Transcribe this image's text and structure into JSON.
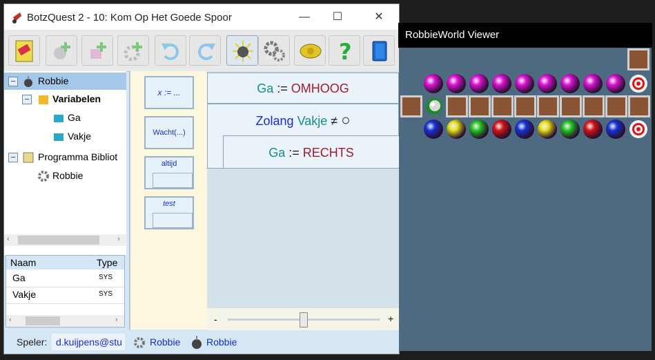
{
  "main_window": {
    "title": "BotzQuest 2 - 10: Kom Op Het Goede Spoor",
    "controls": {
      "minimize": "—",
      "maximize": "☐",
      "close": "✕"
    }
  },
  "toolbar": {
    "buttons": [
      {
        "name": "new-program-icon"
      },
      {
        "name": "add-robot-icon"
      },
      {
        "name": "add-variable-icon"
      },
      {
        "name": "add-setting-icon"
      },
      {
        "name": "undo-icon"
      },
      {
        "name": "redo-icon"
      },
      {
        "name": "run-robot-icon",
        "active": true
      },
      {
        "name": "gears-icon"
      },
      {
        "name": "badge-icon"
      },
      {
        "name": "help-icon"
      },
      {
        "name": "book-icon"
      }
    ]
  },
  "tree": {
    "root": "Robbie",
    "variables_group": "Variabelen",
    "variables": [
      "Ga",
      "Vakje"
    ],
    "library": "Programma Bibliot",
    "library_item": "Robbie"
  },
  "var_table": {
    "headers": [
      "Naam",
      "Type"
    ],
    "rows": [
      [
        "Ga",
        "SYS"
      ],
      [
        "Vakje",
        "SYS"
      ]
    ]
  },
  "status": {
    "label": "Speler:",
    "player": "d.kuijpens@stu",
    "setting": "Robbie",
    "robot": "Robbie"
  },
  "palette": {
    "assign": "x := ...",
    "wait": "Wacht(...)",
    "always": "altijd",
    "test": "test"
  },
  "program": {
    "line1": {
      "var": "Ga",
      "op": ":=",
      "val": "OMHOOG"
    },
    "line2": {
      "kw": "Zolang",
      "var": "Vakje",
      "op": "≠",
      "symbol": "○"
    },
    "line3": {
      "var": "Ga",
      "op": ":=",
      "val": "RECHTS"
    }
  },
  "zoom": {
    "minus": "-",
    "plus": "+",
    "level": 0.5
  },
  "viewer": {
    "title": "RobbieWorld Viewer",
    "colors": {
      "magenta": "#e012d6",
      "blue": "#1633d8",
      "yellow": "#e8e018",
      "green": "#22c81e",
      "red": "#d81414",
      "crate": "#8a5535",
      "target": "#d81818"
    },
    "rows": [
      [
        "",
        "",
        "",
        "",
        "",
        "",
        "",
        "",
        "",
        "",
        "crate"
      ],
      [
        "magenta",
        "magenta",
        "magenta",
        "magenta",
        "magenta",
        "magenta",
        "magenta",
        "magenta",
        "magenta",
        "target"
      ],
      [
        "crate",
        "robot",
        "crate",
        "crate",
        "crate",
        "crate",
        "crate",
        "crate",
        "crate",
        "crate",
        "crate"
      ],
      [
        "blue",
        "yellow",
        "green",
        "red",
        "blue",
        "yellow",
        "green",
        "red",
        "blue",
        "target"
      ]
    ]
  }
}
